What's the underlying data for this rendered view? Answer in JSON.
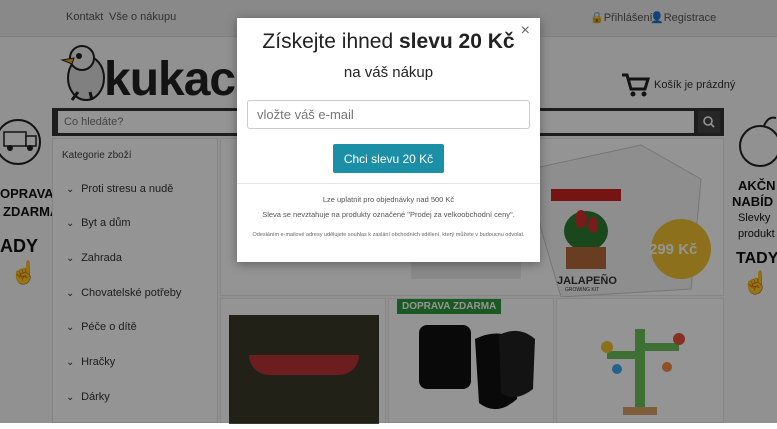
{
  "topbar": {
    "links": [
      "Kontakt",
      "Vše o nákupu"
    ],
    "login": "Přihlášení",
    "register": "Registrace"
  },
  "logo": {
    "text": "kukac"
  },
  "cart": {
    "label": "Košík je prázdný"
  },
  "search": {
    "placeholder": "Co hledáte?"
  },
  "categories": {
    "header": "Kategorie zboží",
    "items": [
      "Proti stresu a nudě",
      "Byt a dům",
      "Zahrada",
      "Chovatelské potřeby",
      "Péče o dítě",
      "Hračky",
      "Dárky"
    ]
  },
  "left_promo": {
    "line1": "OPRAVA",
    "line2": "ZDARMA",
    "line3": "ADY",
    "icon_text": "DOPRAVA ZDARMA"
  },
  "right_promo": {
    "line1": "AKČN",
    "line2": "NABÍD",
    "line3": "Slevky",
    "line4": "produkt",
    "line5": "TADY"
  },
  "banner": {
    "price": "299 Kč",
    "product_name": "JALAPEÑO",
    "product_sub": "GROWING KIT"
  },
  "badge": {
    "label": "DOPRAVA ZDARMA"
  },
  "modal": {
    "close": "×",
    "title_prefix": "Získejte ihned ",
    "title_bold": "slevu 20 Kč",
    "subtitle": "na váš nákup",
    "email_placeholder": "vložte váš e-mail",
    "button": "Chci slevu 20 Kč",
    "note1": "Lze uplatnit pro objednávky nad 500 Kč",
    "note2": "Sleva se nevztahuje na produkty označené \"Prodej za velkoobchodní ceny\".",
    "fine": "Odesláním e-mailové adresy udělujete souhlas k zaslání obchodních sdělení, který můžete v budoucnu odvolat."
  },
  "colors": {
    "accent": "#1b8fa6",
    "badge": "#2e9a3c",
    "price_circle": "#f2c230"
  }
}
